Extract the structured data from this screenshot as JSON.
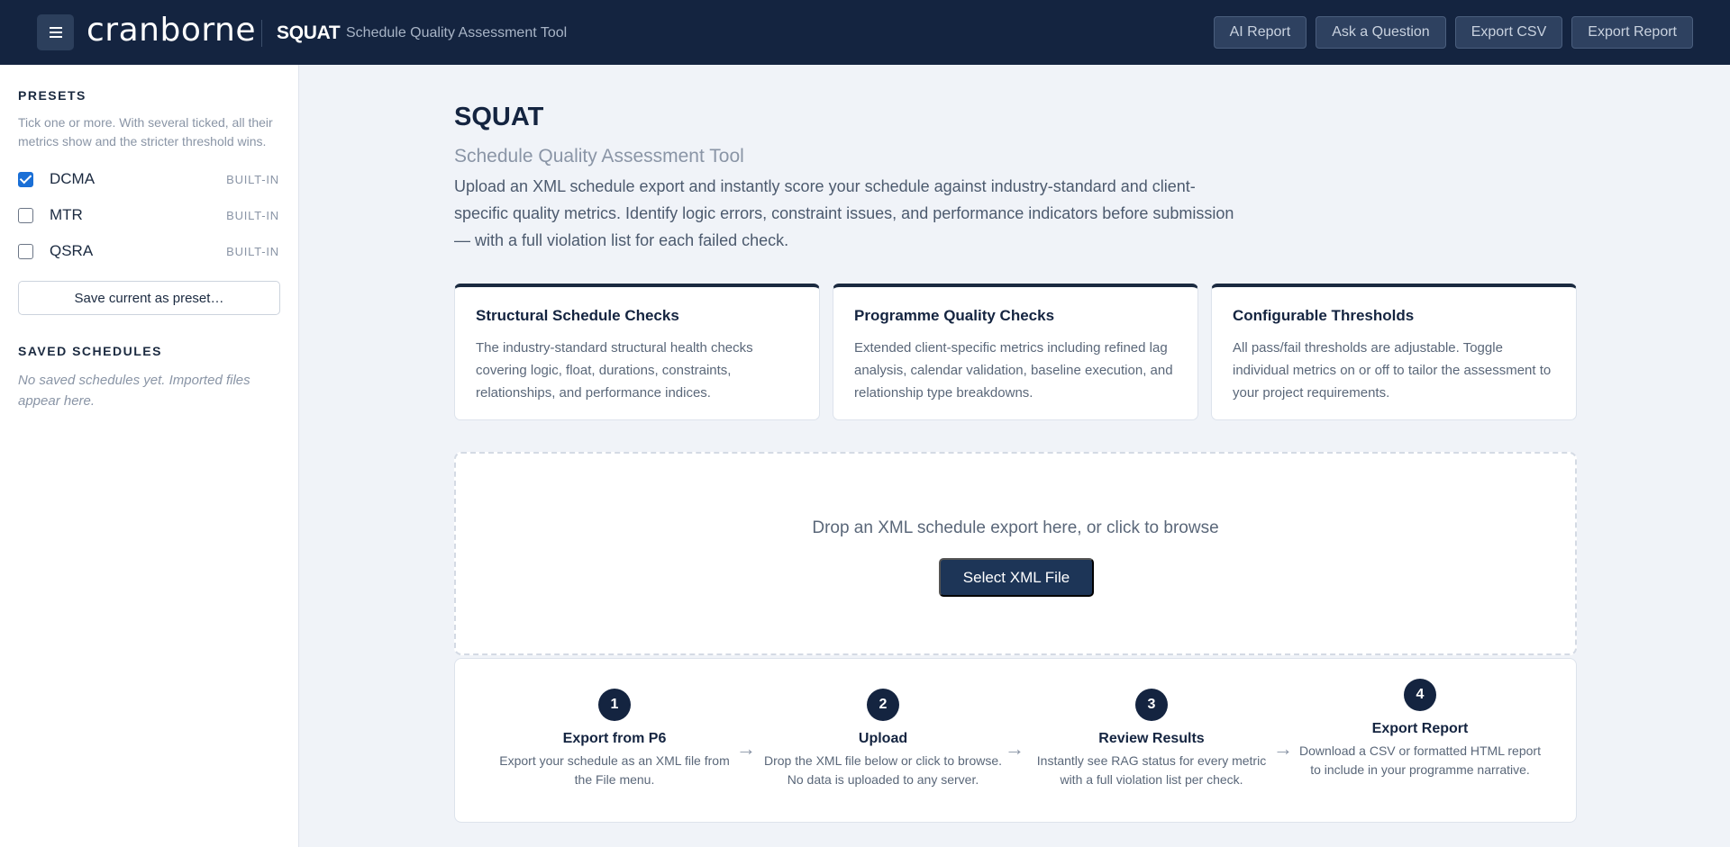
{
  "header": {
    "menu_icon": "hamburger-icon",
    "logo": "cranborne",
    "app_name": "SQUAT",
    "app_subtitle": "Schedule Quality Assessment Tool",
    "actions": [
      "AI Report",
      "Ask a Question",
      "Export CSV",
      "Export Report"
    ]
  },
  "sidebar": {
    "presets_heading": "PRESETS",
    "presets_help": "Tick one or more. With several ticked, all their metrics show and the stricter threshold wins.",
    "presets": [
      {
        "name": "DCMA",
        "tag": "BUILT-IN",
        "checked": true
      },
      {
        "name": "MTR",
        "tag": "BUILT-IN",
        "checked": false
      },
      {
        "name": "QSRA",
        "tag": "BUILT-IN",
        "checked": false
      }
    ],
    "save_preset_label": "Save current as preset…",
    "saved_heading": "SAVED SCHEDULES",
    "saved_empty": "No saved schedules yet. Imported files appear here."
  },
  "main": {
    "title": "SQUAT",
    "subtitle": "Schedule Quality Assessment Tool",
    "description": "Upload an XML schedule export and instantly score your schedule against industry-standard and client-specific quality metrics. Identify logic errors, constraint issues, and performance indicators before submission — with a full violation list for each failed check.",
    "cards": [
      {
        "title": "Structural Schedule Checks",
        "text": "The industry-standard structural health checks covering logic, float, durations, constraints, relationships, and performance indices."
      },
      {
        "title": "Programme Quality Checks",
        "text": "Extended client-specific metrics including refined lag analysis, calendar validation, baseline execution, and relationship type breakdowns."
      },
      {
        "title": "Configurable Thresholds",
        "text": "All pass/fail thresholds are adjustable. Toggle individual metrics on or off to tailor the assessment to your project requirements."
      }
    ],
    "dropzone_text": "Drop an XML schedule export here, or click to browse",
    "select_button": "Select XML File",
    "steps": [
      {
        "num": "1",
        "title": "Export from P6",
        "text": "Export your schedule as an XML file from the File menu."
      },
      {
        "num": "2",
        "title": "Upload",
        "text": "Drop the XML file below or click to browse. No data is uploaded to any server."
      },
      {
        "num": "3",
        "title": "Review Results",
        "text": "Instantly see RAG status for every metric with a full violation list per check."
      },
      {
        "num": "4",
        "title": "Export Report",
        "text": "Download a CSV or formatted HTML report to include in your programme narrative."
      }
    ],
    "step_arrow": "→"
  },
  "colors": {
    "header_bg": "#142440",
    "accent_button": "#1d3557",
    "checkbox_checked": "#1a6fd6",
    "page_bg": "#f0f3f8"
  }
}
